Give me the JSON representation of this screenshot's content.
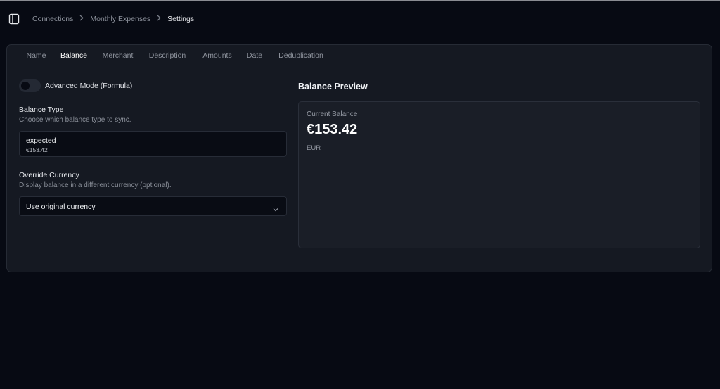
{
  "breadcrumb": {
    "items": [
      "Connections",
      "Monthly Expenses",
      "Settings"
    ]
  },
  "tabs": [
    {
      "label": "Name",
      "active": false
    },
    {
      "label": "Balance",
      "active": true
    },
    {
      "label": "Merchant",
      "active": false
    },
    {
      "label": "Description",
      "active": false
    },
    {
      "label": "Amounts",
      "active": false
    },
    {
      "label": "Date",
      "active": false
    },
    {
      "label": "Deduplication",
      "active": false
    }
  ],
  "advanced_mode": {
    "label": "Advanced Mode (Formula)",
    "enabled": false
  },
  "balance_type": {
    "label": "Balance Type",
    "help": "Choose which balance type to sync.",
    "selected": "expected",
    "selected_detail": "€153.42"
  },
  "override_currency": {
    "label": "Override Currency",
    "help": "Display balance in a different currency (optional).",
    "selected": "Use original currency"
  },
  "preview": {
    "title": "Balance Preview",
    "label": "Current Balance",
    "amount": "€153.42",
    "currency": "EUR"
  },
  "colors": {
    "background": "#070a13",
    "card": "#151922",
    "preview_box": "#1a1e27",
    "border": "#262b35",
    "active_tab": "#ffffff"
  }
}
